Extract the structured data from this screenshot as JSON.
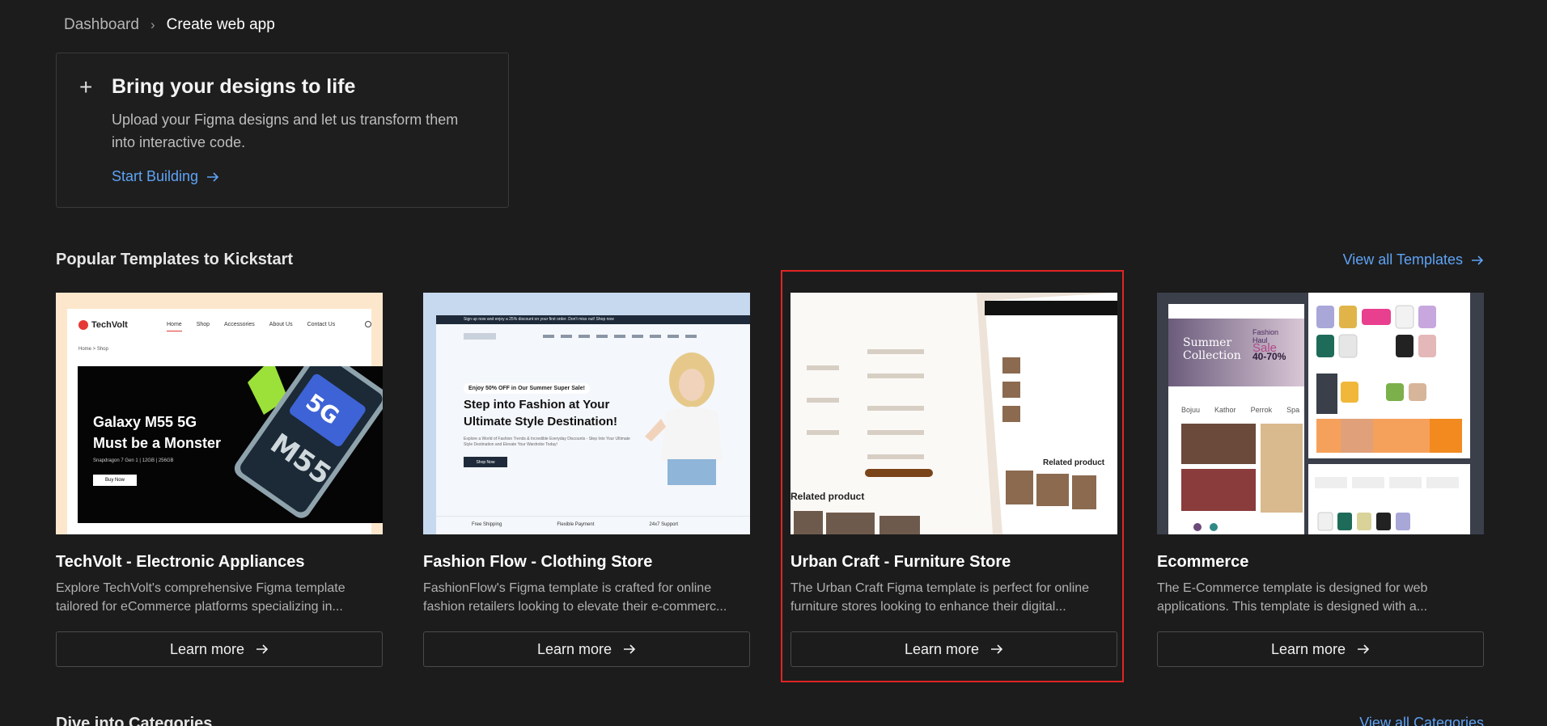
{
  "breadcrumb": {
    "parent": "Dashboard",
    "current": "Create web app"
  },
  "hero": {
    "title": "Bring your designs to life",
    "description": "Upload your Figma designs and let us transform them into interactive code.",
    "cta": "Start Building"
  },
  "templates_section": {
    "title": "Popular Templates to Kickstart",
    "view_all": "View all Templates"
  },
  "cards": [
    {
      "title": "TechVolt - Electronic Appliances",
      "desc_line1": "Explore TechVolt's comprehensive Figma template",
      "desc_line2": "tailored for eCommerce platforms specializing in...",
      "button": "Learn more",
      "thumb": {
        "brand": "TechVolt",
        "nav": [
          "Home",
          "Shop",
          "Accessories",
          "About Us",
          "Contact Us"
        ],
        "crumb": "Home  >  Shop",
        "headline1": "Galaxy M55 5G",
        "headline2": "Must be a Monster",
        "sub": "Snapdragon 7 Gen 1 | 12GB | 256GB",
        "btn": "Buy Now"
      }
    },
    {
      "title": "Fashion Flow - Clothing Store",
      "desc_line1": "FashionFlow's Figma template is crafted for online",
      "desc_line2": "fashion retailers looking to elevate their e-commerc...",
      "button": "Learn more",
      "thumb": {
        "promo": "Sign up now and enjoy a 25% discount on your first order. Don't miss out! Shop now",
        "badge": "Enjoy 50% OFF in Our Summer Super Sale!",
        "headline1": "Step into Fashion at Your",
        "headline2": "Ultimate Style Destination!",
        "sub": "Explore a World of Fashion Trends & Incredible Everyday Discounts - Step Into Your Ultimate Style Destination and Elevate Your Wardrobe Today!",
        "btn": "Shop Now",
        "features": [
          "Free Shipping",
          "Flexible Payment",
          "24x7 Support"
        ]
      }
    },
    {
      "title": "Urban Craft - Furniture Store",
      "desc_line1": "The Urban Craft Figma template is perfect for online",
      "desc_line2": "furniture stores looking to enhance their digital...",
      "button": "Learn more",
      "thumb": {
        "related1": "Related product",
        "related2": "Related product"
      }
    },
    {
      "title": "Ecommerce",
      "desc_line1": "The E-Commerce template is designed for web",
      "desc_line2": "applications. This template is designed with a...",
      "button": "Learn more",
      "thumb": {
        "hero1": "Summer",
        "hero2": "Collection",
        "sale1": "Fashion",
        "sale2": "Haul",
        "sale3": "Sale",
        "pct": "40-70%",
        "brands": [
          "Bojuu",
          "Kathor",
          "Perrok",
          "Spa"
        ]
      }
    }
  ],
  "categories_section": {
    "title": "Dive into Categories",
    "view_all": "View all Categories"
  },
  "colors": {
    "background": "#1c1c1c",
    "accent": "#5fa3f5",
    "highlight": "#e02424"
  }
}
